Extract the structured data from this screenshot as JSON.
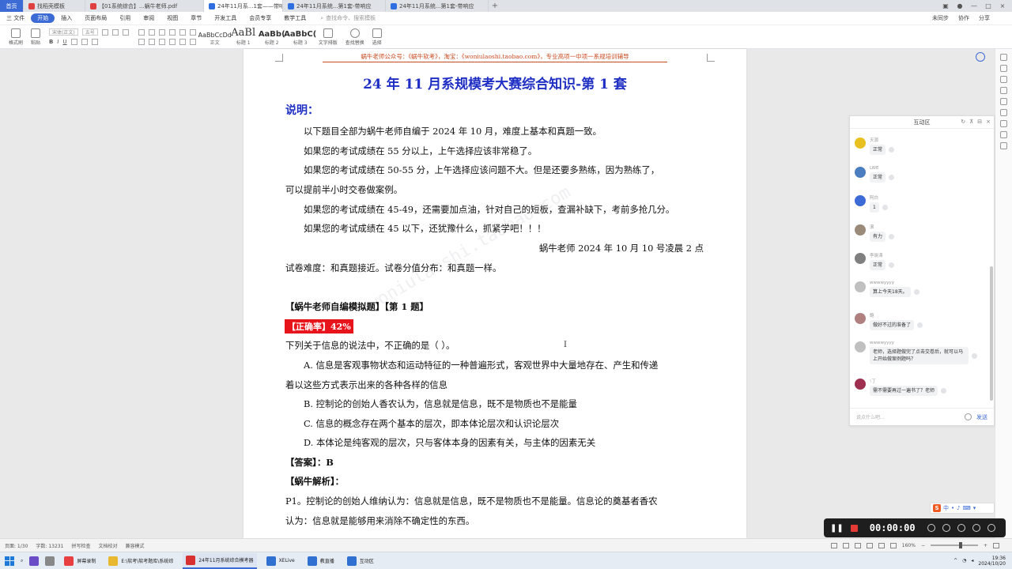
{
  "tabs": [
    {
      "label": "首页",
      "color": "#3d6bd6"
    },
    {
      "label": "找稻壳模板",
      "color": "#e04040"
    },
    {
      "label": "【01系统综合】...蜗牛老师.pdf",
      "color": "#e04040"
    },
    {
      "label": "24年11月系...1套——带响计",
      "color": "#2f6ee0"
    },
    {
      "label": "24年11月系统...第1套-带响应",
      "color": "#2f6ee0"
    },
    {
      "label": "24年11月系统...第1套-带响应",
      "color": "#2f6ee0"
    }
  ],
  "menu": {
    "items": [
      "三 文件",
      "开始",
      "插入",
      "页面布局",
      "引用",
      "审阅",
      "视图",
      "章节",
      "开发工具",
      "会员专享",
      "教学工具"
    ],
    "active_index": 1,
    "search_placeholder": "查找命令、搜索模板",
    "right": [
      "未同步",
      "协作",
      "分享"
    ]
  },
  "ribbon": {
    "left_blocks": [
      "格式刷",
      "粘贴"
    ],
    "font_name": "宋体(正文)",
    "font_size": "五号",
    "styles": [
      {
        "sample": "AaBbCcDd",
        "label": "正文",
        "kind": "small"
      },
      {
        "sample": "AaBl",
        "label": "标题 1",
        "kind": "big"
      },
      {
        "sample": "AaBb(",
        "label": "标题 2",
        "kind": "mid"
      },
      {
        "sample": "AaBbC(",
        "label": "标题 3",
        "kind": "mid"
      }
    ],
    "right_blocks": [
      "文字排版",
      "查找替换",
      "选择"
    ]
  },
  "document": {
    "header_text": "蜗牛老师公众号：《蜗牛软考》，淘宝：《woniulaoshi.taobao.com》，专业高项一中项一系规培训辅导",
    "title": "24 年 11 月系规模考大赛综合知识-第 1 套",
    "section_heading": "说明：",
    "intro": [
      "以下题目全部为蜗牛老师自编于 2024 年 10 月，难度上基本和真题一致。",
      "如果您的考试成绩在 55 分以上，上午选择应该非常稳了。",
      "如果您的考试成绩在 50-55 分，上午选择应该问题不大。但是还要多熟练，因为熟练了，",
      "可以提前半小时交卷做案例。",
      "如果您的考试成绩在 45-49，还需要加点油，针对自己的短板，查漏补缺下，考前多抢几分。",
      "如果您的考试成绩在 45 以下，还犹豫什么，抓紧学吧！！！"
    ],
    "signature": "蜗牛老师 2024 年 10 月 10 号凌晨 2 点",
    "difficulty": "试卷难度：和真题接近。试卷分值分布：和真题一样。",
    "question_header": "【蜗牛老师自编模拟题】【第 1 题】",
    "accuracy_tag": "【正确率】42%",
    "question": "下列关于信息的说法中，不正确的是（ ）。",
    "options": [
      "A. 信息是客观事物状态和运动特征的一种普遍形式，客观世界中大量地存在、产生和传递",
      "着以这些方式表示出来的各种各样的信息",
      "B. 控制论的创始人香农认为，信息就是信息，既不是物质也不是能量",
      "C. 信息的概念存在两个基本的层次，即本体论层次和认识论层次",
      "D. 本体论是纯客观的层次，只与客体本身的因素有关，与主体的因素无关"
    ],
    "answer": "【答案】：B",
    "analysis_header": "【蜗牛解析】：",
    "analysis": [
      "P1。控制论的创始人维纳认为：信息就是信息，既不是物质也不是能量。信息论的奠基者香农",
      "认为：信息就是能够用来消除不确定性的东西。"
    ],
    "watermark": "woniulaoshi.taobao.com"
  },
  "chat": {
    "title": "互动区",
    "messages": [
      {
        "name": "天源",
        "text": "正常",
        "avatar": "#e8c020"
      },
      {
        "name": "LWE",
        "text": "正常",
        "avatar": "#4a7ec0"
      },
      {
        "name": "阿白",
        "text": "1",
        "avatar": "#3d6bd6"
      },
      {
        "name": "滚",
        "text": "有力",
        "avatar": "#9a8a7a"
      },
      {
        "name": "李晓涛",
        "text": "正常",
        "avatar": "#808080"
      },
      {
        "name": "wwwwyyyy",
        "text": "算上今天18天。",
        "avatar": "#c0c0c0"
      },
      {
        "name": "鲍",
        "text": "做好不过的准备了",
        "avatar": "#b08080"
      },
      {
        "name": "wwwwyyyy",
        "text": "老师，选择题做完了点击交卷后，就可以马上开始做案例题吗？",
        "avatar": "#c0c0c0"
      },
      {
        "name": "ʳᵢ丁",
        "text": "需不需要再过一遍书了？老师",
        "avatar": "#a03050"
      }
    ],
    "input_placeholder": "说点什么吧...",
    "send_label": "发送"
  },
  "ime": {
    "logo": "S",
    "label": "中"
  },
  "recorder": {
    "time": "00:00:00"
  },
  "statusbar": {
    "page": "页面: 1/30",
    "words": "字数: 13231",
    "spell": "拼写检查",
    "proof": "文档校对",
    "compat": "兼容模式",
    "zoom": "160%"
  },
  "taskbar": {
    "apps": [
      "屏幕录制",
      "E:\\软考\\软考题库\\系统综",
      "24年11月系统综合模考器",
      "XELive",
      "教直播",
      "互动区"
    ],
    "active_index": 2,
    "time": "19:36",
    "date": "2024/10/20"
  }
}
